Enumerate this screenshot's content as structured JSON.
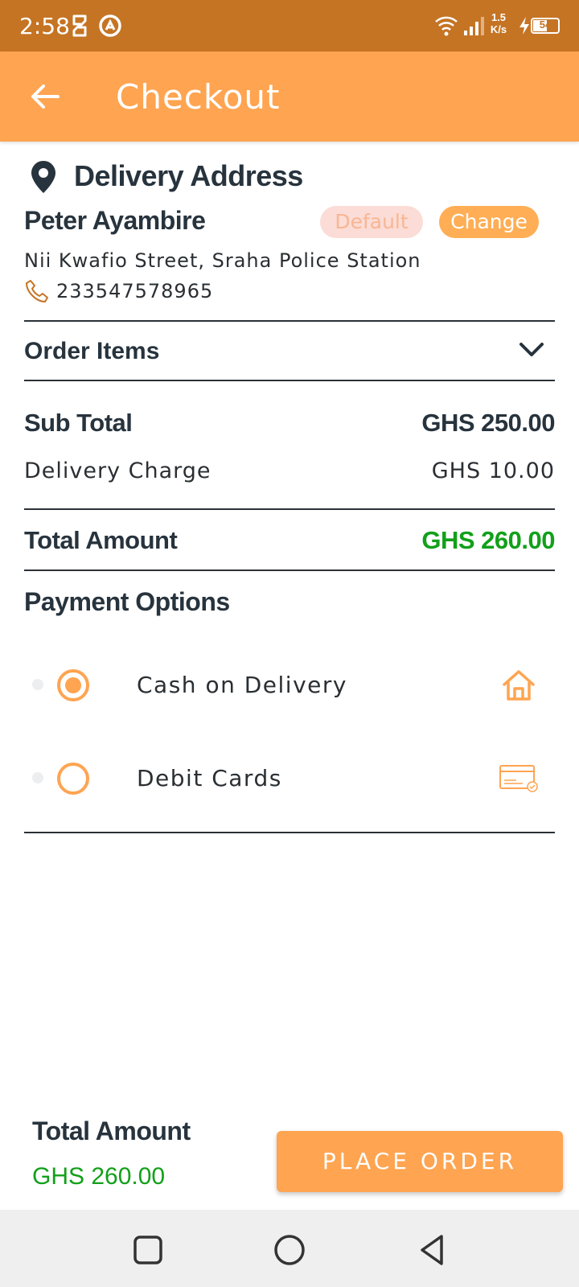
{
  "status_bar": {
    "time": "2:58",
    "net_speed_value": "1.5",
    "net_speed_unit": "K/s",
    "battery": "54",
    "icons": [
      "sim-app-icon",
      "vpn-icon",
      "wifi-icon",
      "signal-icon",
      "charging-icon",
      "battery-icon"
    ]
  },
  "app_bar": {
    "title": "Checkout",
    "back_icon": "arrow-left-icon"
  },
  "address": {
    "heading": "Delivery Address",
    "name": "Peter Ayambire",
    "default_badge": "Default",
    "change_label": "Change",
    "street": "Nii Kwafio Street, Sraha Police Station",
    "phone": "233547578965"
  },
  "order_items": {
    "label": "Order Items"
  },
  "summary": {
    "subtotal_label": "Sub Total",
    "subtotal_value": "GHS 250.00",
    "delivery_label": "Delivery Charge",
    "delivery_value": "GHS 10.00",
    "total_label": "Total Amount",
    "total_value": "GHS 260.00"
  },
  "payment": {
    "heading": "Payment Options",
    "options": [
      {
        "label": "Cash on Delivery",
        "selected": true,
        "icon": "house-icon"
      },
      {
        "label": "Debit Cards",
        "selected": false,
        "icon": "credit-card-icon"
      }
    ]
  },
  "footer": {
    "total_label": "Total Amount",
    "total_value": "GHS 260.00",
    "place_order_label": "PLACE ORDER"
  },
  "colors": {
    "status_bar": "#c57424",
    "accent": "#ffa451",
    "price_green": "#12a01a",
    "text_dark": "#27333d"
  }
}
